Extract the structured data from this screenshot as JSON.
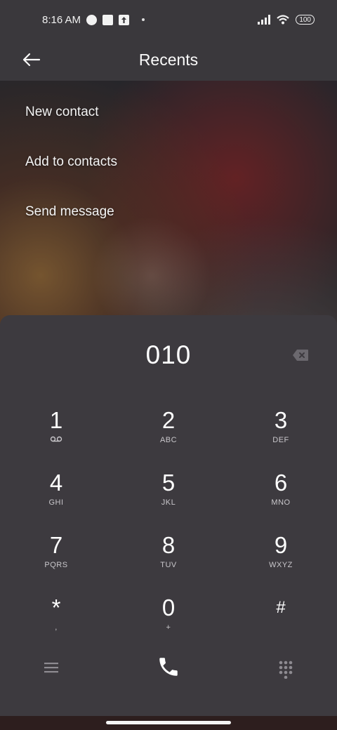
{
  "status_bar": {
    "time": "8:16 AM",
    "battery": "100"
  },
  "app_bar": {
    "title": "Recents",
    "back_icon": "arrow-left-icon"
  },
  "actions": [
    {
      "label": "New contact"
    },
    {
      "label": "Add to contacts"
    },
    {
      "label": "Send message"
    }
  ],
  "dialer": {
    "number": "010",
    "keys": [
      {
        "digit": "1",
        "sub": "",
        "sub_icon": "voicemail-icon"
      },
      {
        "digit": "2",
        "sub": "ABC"
      },
      {
        "digit": "3",
        "sub": "DEF"
      },
      {
        "digit": "4",
        "sub": "GHI"
      },
      {
        "digit": "5",
        "sub": "JKL"
      },
      {
        "digit": "6",
        "sub": "MNO"
      },
      {
        "digit": "7",
        "sub": "PQRS"
      },
      {
        "digit": "8",
        "sub": "TUV"
      },
      {
        "digit": "9",
        "sub": "WXYZ"
      },
      {
        "digit": "*",
        "sub": ","
      },
      {
        "digit": "0",
        "sub": "+"
      },
      {
        "digit": "#",
        "sub": ""
      }
    ]
  },
  "colors": {
    "panel": "#3d3a3f",
    "bar": "#3a383c",
    "text": "#ffffff",
    "sub_text": "#c9c7cb"
  }
}
